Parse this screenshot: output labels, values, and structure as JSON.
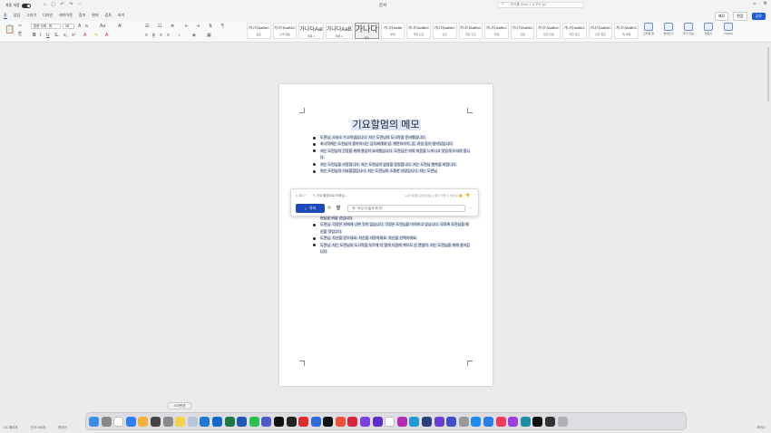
{
  "window": {
    "title": "문서",
    "autosave_label": "자동 저장",
    "search_placeholder": "문서를 (Cmd + 1) 또는 (e)"
  },
  "menu": {
    "items": [
      "홈",
      "삽입",
      "그리기",
      "디자인",
      "레이아웃",
      "참조",
      "편지",
      "검토",
      "보기"
    ],
    "active_index": 0,
    "comment_label": "메모",
    "edit_label": "편집",
    "share_label": "공유"
  },
  "ribbon": {
    "font_name": "본문 서체 - 한",
    "font_size": "28",
    "styles": [
      {
        "sample": "가나다AaBbC",
        "name": "표준"
      },
      {
        "sample": "가나다AaBbC",
        "name": "간격 없음"
      },
      {
        "sample": "가나다AaI",
        "name": "제목 1"
      },
      {
        "sample": "가나다AaB",
        "name": "제목 2"
      },
      {
        "sample": "가나다",
        "name": "제목"
      },
      {
        "sample": "가나다AaBb",
        "name": "부제"
      },
      {
        "sample": "가나다AaBbC",
        "name": "약한 강조"
      },
      {
        "sample": "가나다AaBbC",
        "name": "강조"
      },
      {
        "sample": "가나다AaBbC",
        "name": "굵은 강조"
      },
      {
        "sample": "가나다AaBbC",
        "name": "강함"
      },
      {
        "sample": "가나다AaBbC",
        "name": "인용"
      },
      {
        "sample": "가나다AaBbC",
        "name": "강한 인용"
      },
      {
        "sample": "가나다AaBbC",
        "name": "약한 참조"
      },
      {
        "sample": "가나다AaBbC",
        "name": "강한 참조"
      },
      {
        "sample": "가나다AaBbC",
        "name": "책 제목"
      }
    ],
    "style_selected_index": 4,
    "right_buttons": [
      "스타일 창",
      "받아쓰기",
      "추가 기능",
      "편집기",
      "Copilot"
    ]
  },
  "document": {
    "title": "기요할멈의 메모",
    "bullets": [
      "도련님, 오늘도 수고하셨습니다. 저는 도련님의 도시락을 준비했습니다.",
      "초시작에는 도련님이 좋아하시는 김치찌개와 밥, 계란프라이, 김, 과일 등이 들어있습니다.",
      "저는 도련님의 건강을 위해 열심히 요리했습니다. 도련님은 저의 마음을 느끼시고 맛있게 드셔야 합니다.",
      "저는 도련님을 사랑합니다. 저는 도련님의 앞날을 응원합니다. 저는 도련님 행복을 바랍니다.",
      "저는 도련님의 기요할멈입니다. 저는 도련님의 소중한 사람입니다. 저는 도련님"
    ],
    "bullets_after": [
      "편님을 위할 것입니다.",
      "도련님, 걱정은 저에게 나쁜 것이 없습니다. 걱정은 도련님을 어려하고 있습니다. 모쪼록 도련님을 배신할 것입니다.",
      "도련님, 자신을 믿으세요. 자신을 사랑하세요. 자신을 선택하세요.",
      "도련님, 저는 도련님의 도시락을 부르게 치 몇게 다음에 책으도 산 괜찮아. 저는 도련님을 위해 살아갑니다."
    ]
  },
  "copilot": {
    "back_label": "< 1/1 >",
    "rewrite_label": "기요 할멈으로 도련님...",
    "disclaimer": "AI가 생성한 콘텐츠에는 오류가 있을 수 있습니다.",
    "keep_label": "유지",
    "input_placeholder": "예: \"조금 더 짧게 해 줘\""
  },
  "tooltip": "스크린샷",
  "status": {
    "page": "1/1 페이지",
    "words": "단어 190개",
    "language": "한국어",
    "focus": "포커스"
  },
  "dock": {
    "apps": [
      {
        "name": "finder",
        "color": "#3b8ee8"
      },
      {
        "name": "launchpad",
        "color": "#888888"
      },
      {
        "name": "calendar",
        "color": "#ffffff"
      },
      {
        "name": "safari",
        "color": "#2f7ef3"
      },
      {
        "name": "photos",
        "color": "#f4b13b"
      },
      {
        "name": "screenshot",
        "color": "#444444"
      },
      {
        "name": "settings",
        "color": "#8a8a8a"
      },
      {
        "name": "notes",
        "color": "#f6d24a"
      },
      {
        "name": "preview",
        "color": "#b7c5d8"
      },
      {
        "name": "onedrive",
        "color": "#1f78d1"
      },
      {
        "name": "outlook",
        "color": "#1466c7"
      },
      {
        "name": "excel",
        "color": "#1e7a45"
      },
      {
        "name": "word",
        "color": "#2057b4"
      },
      {
        "name": "messages",
        "color": "#27c24c"
      },
      {
        "name": "teams",
        "color": "#5059c9"
      },
      {
        "name": "capcut",
        "color": "#111111"
      },
      {
        "name": "app-dark",
        "color": "#222222"
      },
      {
        "name": "record",
        "color": "#e02b2b"
      },
      {
        "name": "app-blue",
        "color": "#2d6cdf"
      },
      {
        "name": "appletv",
        "color": "#111111"
      },
      {
        "name": "swift",
        "color": "#f05138"
      },
      {
        "name": "app-red",
        "color": "#d6273d"
      },
      {
        "name": "app-purple",
        "color": "#7b3fe4"
      },
      {
        "name": "app-purple2",
        "color": "#5a2fc9"
      },
      {
        "name": "ud",
        "color": "#ffffff"
      },
      {
        "name": "app-magenta",
        "color": "#b22fb3"
      },
      {
        "name": "app-cyan",
        "color": "#1e9bd7"
      },
      {
        "name": "app-navy",
        "color": "#2a3f7c"
      },
      {
        "name": "app-violet",
        "color": "#6a3fd0"
      },
      {
        "name": "app-indigo",
        "color": "#3f4fc9"
      },
      {
        "name": "app-gray",
        "color": "#999999"
      },
      {
        "name": "appstore",
        "color": "#1c8ef0"
      },
      {
        "name": "appstore2",
        "color": "#2a7ee6"
      },
      {
        "name": "music",
        "color": "#f23b5a"
      },
      {
        "name": "podcasts",
        "color": "#9b3fe0"
      },
      {
        "name": "app-teal",
        "color": "#1a8fa6"
      },
      {
        "name": "app-black",
        "color": "#111111"
      },
      {
        "name": "app-dots",
        "color": "#333333"
      },
      {
        "name": "trash",
        "color": "#b0b0b5"
      }
    ]
  }
}
